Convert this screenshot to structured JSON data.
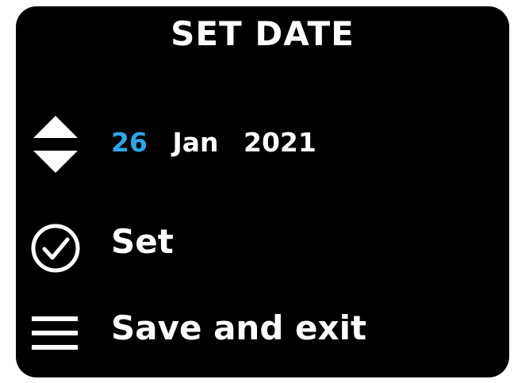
{
  "title": "SET DATE",
  "date": {
    "day": "26",
    "month": "Jan",
    "year": "2021",
    "day_color": "#2ea7ea"
  },
  "menu": {
    "set_label": "Set",
    "save_label": "Save and exit"
  },
  "icons": {
    "adjust": "up-down-arrows-icon",
    "set": "check-circle-icon",
    "save": "menu-lines-icon"
  }
}
